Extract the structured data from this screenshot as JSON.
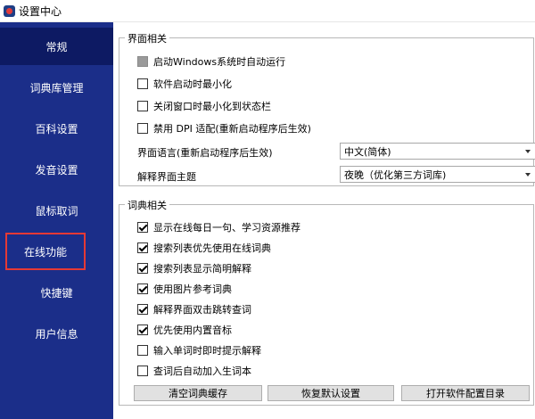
{
  "window": {
    "title": "设置中心"
  },
  "sidebar": {
    "items": [
      {
        "label": "常规"
      },
      {
        "label": "词典库管理"
      },
      {
        "label": "百科设置"
      },
      {
        "label": "发音设置"
      },
      {
        "label": "鼠标取词"
      },
      {
        "label": "在线功能"
      },
      {
        "label": "快捷键"
      },
      {
        "label": "用户信息"
      }
    ],
    "active_index": 0,
    "highlighted_index": 5
  },
  "interface_group": {
    "title": "界面相关",
    "options": [
      {
        "label": "启动Windows系统时自动运行",
        "state": "indeterminate"
      },
      {
        "label": "软件启动时最小化",
        "state": "unchecked"
      },
      {
        "label": "关闭窗口时最小化到状态栏",
        "state": "unchecked"
      },
      {
        "label": "禁用 DPI 适配(重新启动程序后生效)",
        "state": "unchecked"
      }
    ],
    "language_label": "界面语言(重新启动程序后生效)",
    "language_value": "中文(简体)",
    "theme_label": "解释界面主题",
    "theme_value": "夜晚（优化第三方词库)"
  },
  "dictionary_group": {
    "title": "词典相关",
    "options": [
      {
        "label": "显示在线每日一句、学习资源推荐",
        "state": "checked"
      },
      {
        "label": "搜索列表优先使用在线词典",
        "state": "checked"
      },
      {
        "label": "搜索列表显示简明解释",
        "state": "checked"
      },
      {
        "label": "使用图片参考词典",
        "state": "checked"
      },
      {
        "label": "解释界面双击跳转查词",
        "state": "checked"
      },
      {
        "label": "优先使用内置音标",
        "state": "checked"
      },
      {
        "label": "输入单词时即时提示解释",
        "state": "unchecked"
      },
      {
        "label": "查词后自动加入生词本",
        "state": "unchecked"
      }
    ]
  },
  "buttons": {
    "clear_cache": "清空词典缓存",
    "restore_defaults": "恢复默认设置",
    "open_config": "打开软件配置目录"
  },
  "colors": {
    "sidebar_bg": "#1b2e89",
    "sidebar_active": "#0d1a63",
    "highlight_border": "#e53935"
  }
}
